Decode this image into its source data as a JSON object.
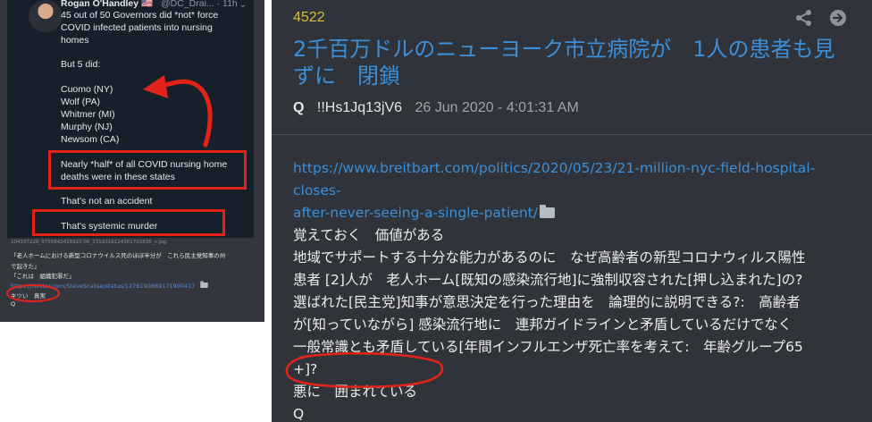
{
  "tweet": {
    "name": "Rogan O'Handley",
    "flag": "🇺🇸",
    "handle": "@DC_Drai... · 11h",
    "chevron": "⌄",
    "lines": [
      "45 out of 50 Governors did *not* force",
      "COVID infected patients into nursing",
      "homes",
      "But 5 did:",
      "Cuomo (NY)",
      "Wolf (PA)",
      "Whitmer (MI)",
      "Murphy (NJ)",
      "Newsom (CA)",
      "Nearly *half* of all COVID nursing home",
      "deaths were in these states",
      "That's not an accident",
      "That's systemic murder"
    ]
  },
  "left_notes": {
    "image_caption": "104337228_9755842428920 06_2319316124361702836_n.jpg",
    "line1": "「老人ホームにおける新型コロナウイルス死のほぼ半分が　これら民主党知事の州",
    "line2": "で起きた」",
    "line3": "「これは　組織犯罪だ」",
    "link": "https://twitter.com/SteveScalise/status/1276190869171900417",
    "line4": "キツい　真実",
    "q": "Q"
  },
  "post": {
    "number": "4522",
    "title": "2千百万ドルのニューヨーク市立病院が　1人の患者も見ずに　閉鎖",
    "author": "Q",
    "tripcode": "!!Hs1Jq13jV6",
    "date": "26 Jun 2020 - 4:01:31 AM",
    "link_line1": "https://www.breitbart.com/politics/2020/05/23/21-million-nyc-field-hospital-closes-",
    "link_line2": "after-never-seeing-a-single-patient/",
    "lines": [
      "覚えておく　価値がある",
      "地域でサポートする十分な能力があるのに　なぜ高齢者の新型コロナウィルス陽性",
      "患者 [2]人が　老人ホーム[既知の感染流行地]に強制収容された[押し込まれた]の?",
      "選ばれた[民主党]知事が意思決定を行った理由を　論理的に説明できる?:　高齢者",
      "が[知っていながら] 感染流行地に　連邦ガイドラインと矛盾しているだけでなく",
      "一般常識とも矛盾している[年間インフルエンザ死亡率を考えて:　年齢グループ65",
      "+]?",
      "悪に　囲まれている",
      "Q"
    ]
  },
  "colors": {
    "post_bg": "#30343a",
    "link_blue": "#3b8fd9",
    "number_yellow": "#d6bf3a",
    "annotation_red": "#e3231a"
  },
  "icons": [
    "share-icon",
    "arrow-right-circle-icon",
    "folder-icon"
  ]
}
